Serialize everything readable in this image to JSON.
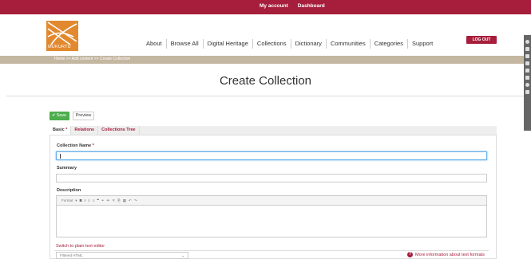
{
  "topbar": {
    "my_account": "My account",
    "dashboard": "Dashboard"
  },
  "header": {
    "logo_text": "MUKURTU",
    "logout": "LOG OUT",
    "nav": [
      "About",
      "Browse All",
      "Digital Heritage",
      "Collections",
      "Dictionary",
      "Communities",
      "Categories",
      "Support"
    ]
  },
  "breadcrumb": "Home >> Add content >> Create Collection",
  "page": {
    "title": "Create Collection"
  },
  "toolbar": {
    "save": "Save",
    "preview": "Preview"
  },
  "tabs": [
    {
      "label": "Basic",
      "required": "*"
    },
    {
      "label": "Relations"
    },
    {
      "label": "Collections Tree"
    }
  ],
  "form": {
    "collection_name": {
      "label": "Collection Name",
      "required": "*",
      "value": ""
    },
    "summary": {
      "label": "Summary",
      "value": ""
    },
    "description": {
      "label": "Description",
      "toolbar": [
        "Format",
        "▾",
        "B",
        "I",
        "≡",
        "≡",
        "❝",
        "⚭",
        "⚮",
        "✕",
        "⎘",
        "▦",
        "↶",
        "↷"
      ]
    },
    "switch_link": "Switch to plain text editor",
    "text_format": {
      "selected": "Filtered HTML"
    },
    "more_info": "More information about text formats"
  },
  "colors": {
    "brand": "#a61e3c",
    "accent": "#e2892f",
    "save": "#4cae4c",
    "breadcrumb_bg": "#c4b7a1"
  }
}
